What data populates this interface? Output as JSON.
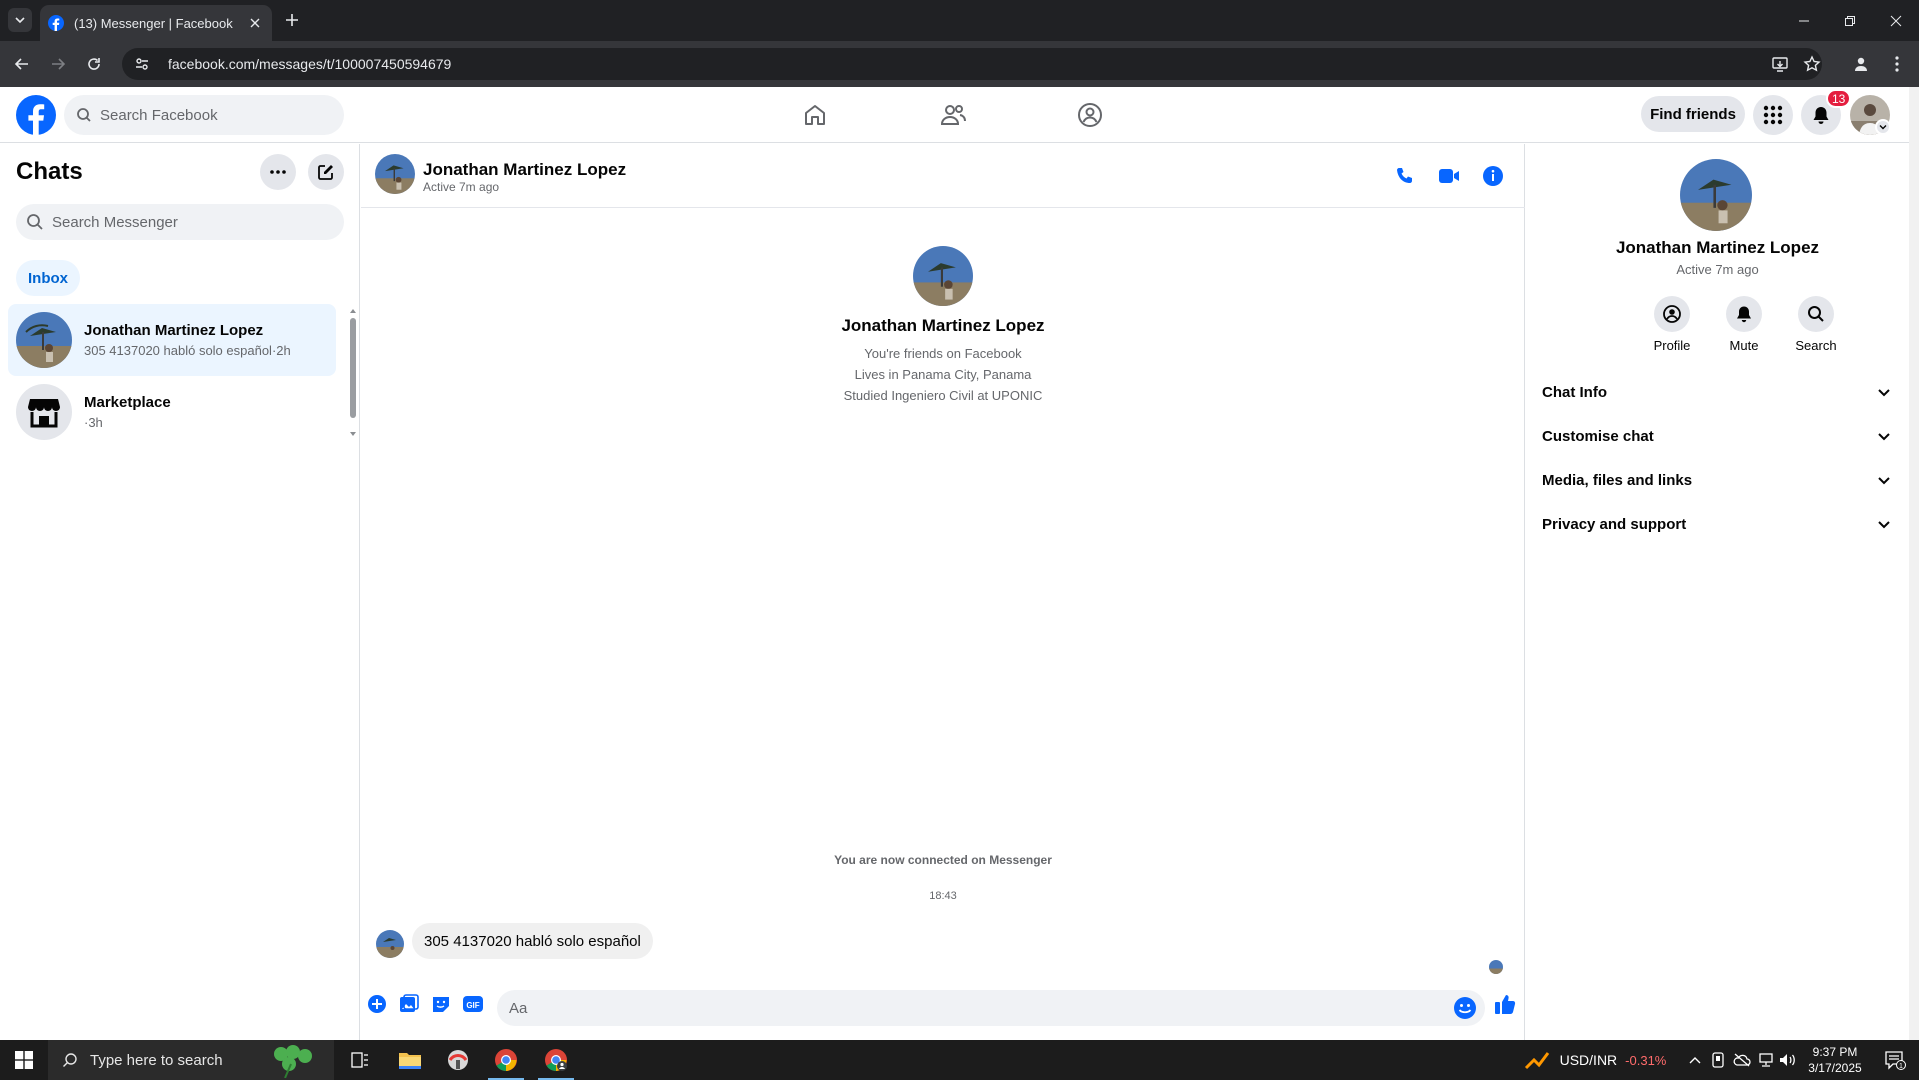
{
  "browser": {
    "tab_title": "(13) Messenger | Facebook",
    "url": "facebook.com/messages/t/100007450594679"
  },
  "header": {
    "search_placeholder": "Search Facebook",
    "find_friends_label": "Find friends",
    "notifications_count": "13",
    "brand_color": "#0866ff"
  },
  "chats": {
    "title": "Chats",
    "search_placeholder": "Search Messenger",
    "inbox_label": "Inbox",
    "items": [
      {
        "name": "Jonathan Martinez Lopez",
        "preview": "305 4137020 habló solo español·2h"
      },
      {
        "name": "Marketplace",
        "preview": "·3h"
      }
    ]
  },
  "conversation": {
    "name": "Jonathan Martinez Lopez",
    "status": "Active 7m ago",
    "profile_name": "Jonathan Martinez Lopez",
    "profile_lines": [
      "You're friends on Facebook",
      "Lives in Panama City, Panama",
      "Studied Ingeniero Civil at UPONIC"
    ],
    "connected_note": "You are now connected on Messenger",
    "timestamp": "18:43",
    "message": "305 4137020 habló solo español",
    "composer_placeholder": "Aa"
  },
  "details": {
    "name": "Jonathan Martinez Lopez",
    "status": "Active 7m ago",
    "actions": [
      "Profile",
      "Mute",
      "Search"
    ],
    "sections": [
      "Chat Info",
      "Customise chat",
      "Media, files and links",
      "Privacy and support"
    ]
  },
  "taskbar": {
    "search_placeholder": "Type here to search",
    "ticker_name": "USD/INR",
    "ticker_value": "-0.31%",
    "time": "9:37 PM",
    "date": "3/17/2025",
    "notification_count": "1"
  }
}
